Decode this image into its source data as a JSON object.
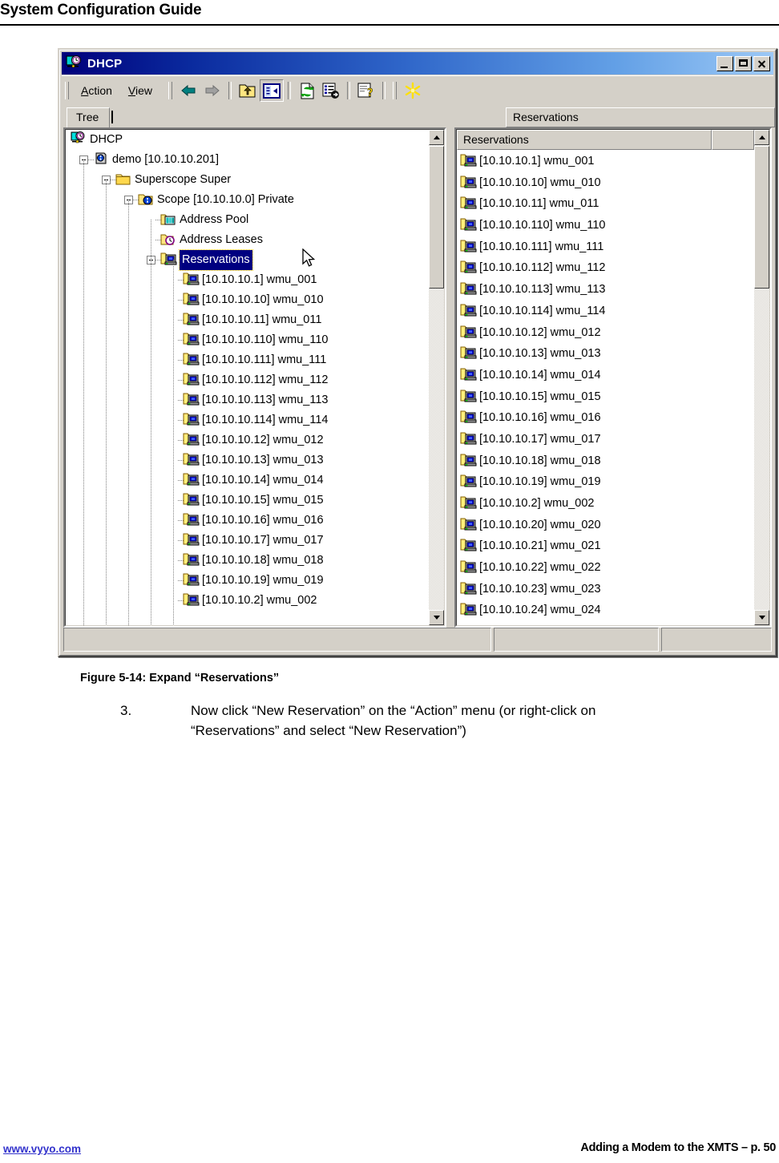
{
  "document": {
    "header_title": "System Configuration Guide",
    "figure_caption": "Figure 5-14: Expand “Reservations”",
    "step_number": "3.",
    "step_text": "Now click “New Reservation” on the “Action” menu (or right-click on “Reservations” and select “New Reservation”)",
    "footer_link": "www.vyyo.com",
    "footer_right": "Adding a Modem to the XMTS – p. 50"
  },
  "window": {
    "title": "DHCP",
    "title_icon": "dhcp-icon",
    "minimize_label": "Minimize",
    "maximize_label": "Maximize",
    "close_label": "Close",
    "accent_title_start": "#00007b",
    "accent_title_end": "#9cc8f5",
    "chrome_color": "#d4d0c8",
    "selection_color": "#000080"
  },
  "menu": [
    {
      "label": "Action",
      "accel": "A"
    },
    {
      "label": "View",
      "accel": "V"
    }
  ],
  "toolbar": [
    {
      "name": "back-icon",
      "title": "Back",
      "pressed": false
    },
    {
      "name": "forward-icon",
      "title": "Forward",
      "pressed": false
    },
    {
      "name": "up-one-level-icon",
      "title": "Up One Level",
      "pressed": false
    },
    {
      "name": "show-hide-tree-icon",
      "title": "Show/Hide Console Tree",
      "pressed": true
    },
    {
      "name": "refresh-icon",
      "title": "Refresh",
      "pressed": false
    },
    {
      "name": "export-list-icon",
      "title": "Export List",
      "pressed": false
    },
    {
      "name": "help-icon",
      "title": "Help",
      "pressed": false
    },
    {
      "name": "new-reservation-icon",
      "title": "New Reservation",
      "pressed": false
    }
  ],
  "tabs": {
    "left_tab": "Tree",
    "right_tab": "Reservations"
  },
  "tree": {
    "root": {
      "label": "DHCP",
      "icon": "dhcp-icon"
    },
    "server": {
      "label": "demo [10.10.10.201]",
      "icon": "server-icon"
    },
    "superscope": {
      "label": "Superscope Super",
      "icon": "folder-icon"
    },
    "scope": {
      "label": "Scope [10.10.10.0] Private",
      "icon": "scope-icon"
    },
    "address_pool": {
      "label": "Address Pool",
      "icon": "address-pool-icon"
    },
    "address_leases": {
      "label": "Address Leases",
      "icon": "address-leases-icon"
    },
    "reservations": {
      "label": "Reservations",
      "icon": "reservations-icon",
      "selected": true
    },
    "reservation_items": [
      "[10.10.10.1] wmu_001",
      "[10.10.10.10] wmu_010",
      "[10.10.10.11] wmu_011",
      "[10.10.10.110] wmu_110",
      "[10.10.10.111] wmu_111",
      "[10.10.10.112] wmu_112",
      "[10.10.10.113] wmu_113",
      "[10.10.10.114] wmu_114",
      "[10.10.10.12] wmu_012",
      "[10.10.10.13] wmu_013",
      "[10.10.10.14] wmu_014",
      "[10.10.10.15] wmu_015",
      "[10.10.10.16] wmu_016",
      "[10.10.10.17] wmu_017",
      "[10.10.10.18] wmu_018",
      "[10.10.10.19] wmu_019",
      "[10.10.10.2] wmu_002"
    ]
  },
  "list_pane": {
    "column_header": "Reservations",
    "items": [
      "[10.10.10.1] wmu_001",
      "[10.10.10.10] wmu_010",
      "[10.10.10.11] wmu_011",
      "[10.10.10.110] wmu_110",
      "[10.10.10.111] wmu_111",
      "[10.10.10.112] wmu_112",
      "[10.10.10.113] wmu_113",
      "[10.10.10.114] wmu_114",
      "[10.10.10.12] wmu_012",
      "[10.10.10.13] wmu_013",
      "[10.10.10.14] wmu_014",
      "[10.10.10.15] wmu_015",
      "[10.10.10.16] wmu_016",
      "[10.10.10.17] wmu_017",
      "[10.10.10.18] wmu_018",
      "[10.10.10.19] wmu_019",
      "[10.10.10.2] wmu_002",
      "[10.10.10.20] wmu_020",
      "[10.10.10.21] wmu_021",
      "[10.10.10.22] wmu_022",
      "[10.10.10.23] wmu_023",
      "[10.10.10.24] wmu_024"
    ]
  },
  "status_bar": {
    "pane1": "",
    "pane2": "",
    "pane3": ""
  }
}
